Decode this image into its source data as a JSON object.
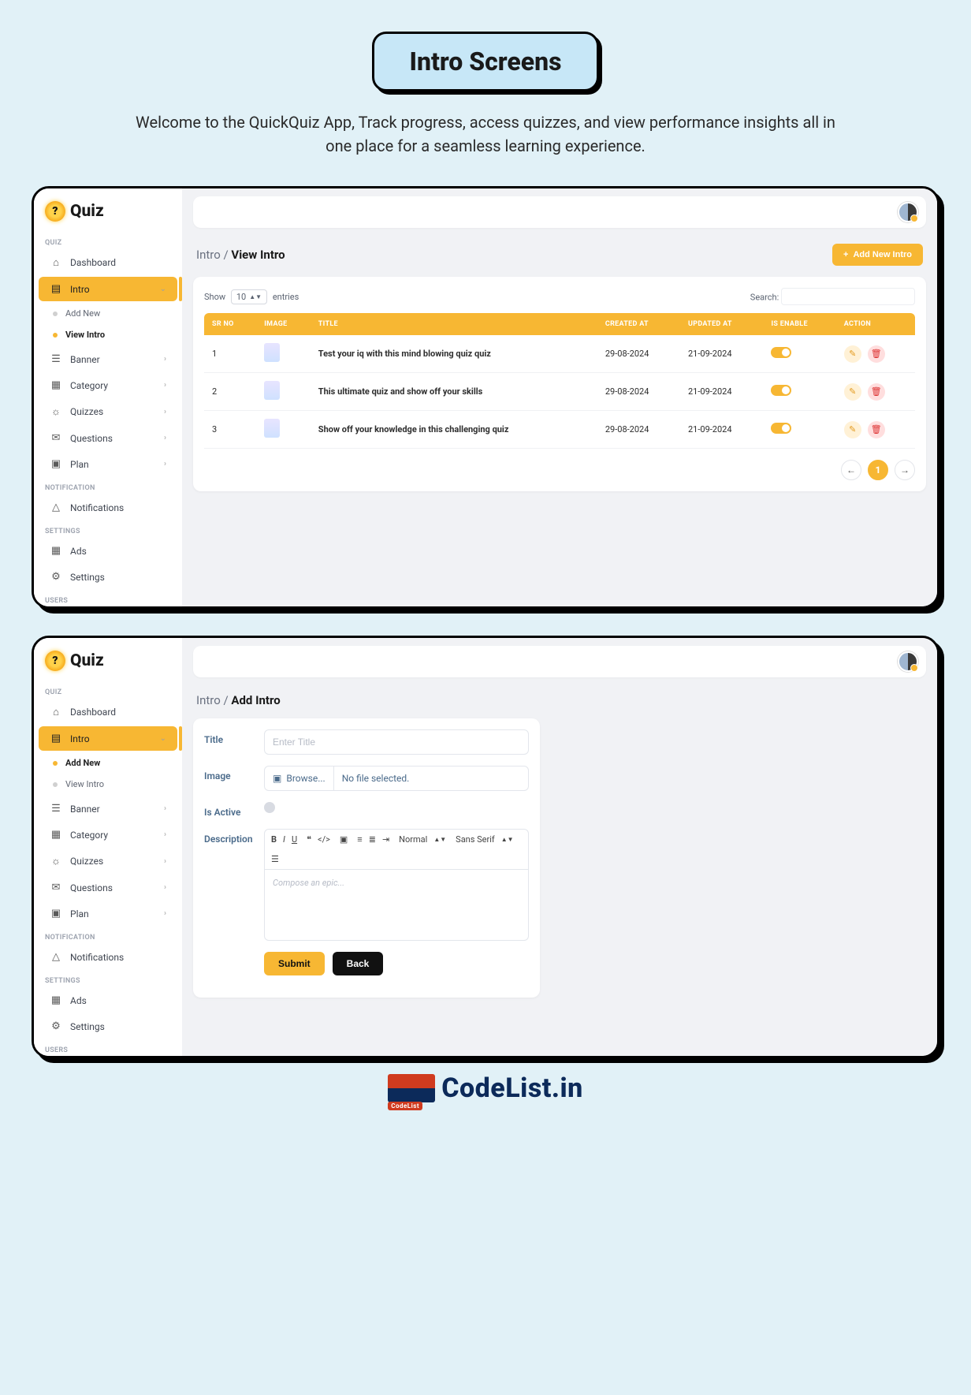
{
  "hero": {
    "title": "Intro Screens",
    "subtitle": "Welcome to the QuickQuiz App, Track progress, access quizzes, and view performance insights all in one place for a seamless learning experience."
  },
  "brand": {
    "name": "Quiz",
    "bulb": "?"
  },
  "sidebar": {
    "sections": {
      "quiz": "QUIZ",
      "notification": "NOTIFICATION",
      "settings": "SETTINGS",
      "users": "USERS"
    },
    "items": {
      "dashboard": "Dashboard",
      "intro": "Intro",
      "addNew": "Add New",
      "viewIntro": "View Intro",
      "banner": "Banner",
      "category": "Category",
      "quizzes": "Quizzes",
      "questions": "Questions",
      "plan": "Plan",
      "notifications": "Notifications",
      "ads": "Ads",
      "settings": "Settings"
    }
  },
  "panel1": {
    "crumb_root": "Intro / ",
    "crumb_leaf": "View Intro",
    "add_btn": "Add New Intro",
    "show_label": "Show",
    "show_value": "10",
    "entries_label": "entries",
    "search_label": "Search:",
    "cols": {
      "sr": "SR NO",
      "image": "IMAGE",
      "title": "TITLE",
      "created": "CREATED AT",
      "updated": "UPDATED AT",
      "enable": "IS ENABLE",
      "action": "ACTION"
    },
    "rows": [
      {
        "sr": "1",
        "title": "Test your iq with this mind blowing quiz quiz",
        "created": "29-08-2024",
        "updated": "21-09-2024"
      },
      {
        "sr": "2",
        "title": "This ultimate quiz and show off your skills",
        "created": "29-08-2024",
        "updated": "21-09-2024"
      },
      {
        "sr": "3",
        "title": "Show off your knowledge in this challenging quiz",
        "created": "29-08-2024",
        "updated": "21-09-2024"
      }
    ],
    "page_current": "1"
  },
  "panel2": {
    "crumb_root": "Intro / ",
    "crumb_leaf": "Add Intro",
    "labels": {
      "title": "Title",
      "image": "Image",
      "isActive": "Is Active",
      "description": "Description"
    },
    "placeholders": {
      "title": "Enter Title",
      "editor": "Compose an epic..."
    },
    "file": {
      "browse": "Browse...",
      "none": "No file selected."
    },
    "toolbar": {
      "normal": "Normal",
      "font": "Sans Serif"
    },
    "buttons": {
      "submit": "Submit",
      "back": "Back"
    }
  },
  "footer": {
    "text": "CodeList.in",
    "sub": "CodeList"
  }
}
